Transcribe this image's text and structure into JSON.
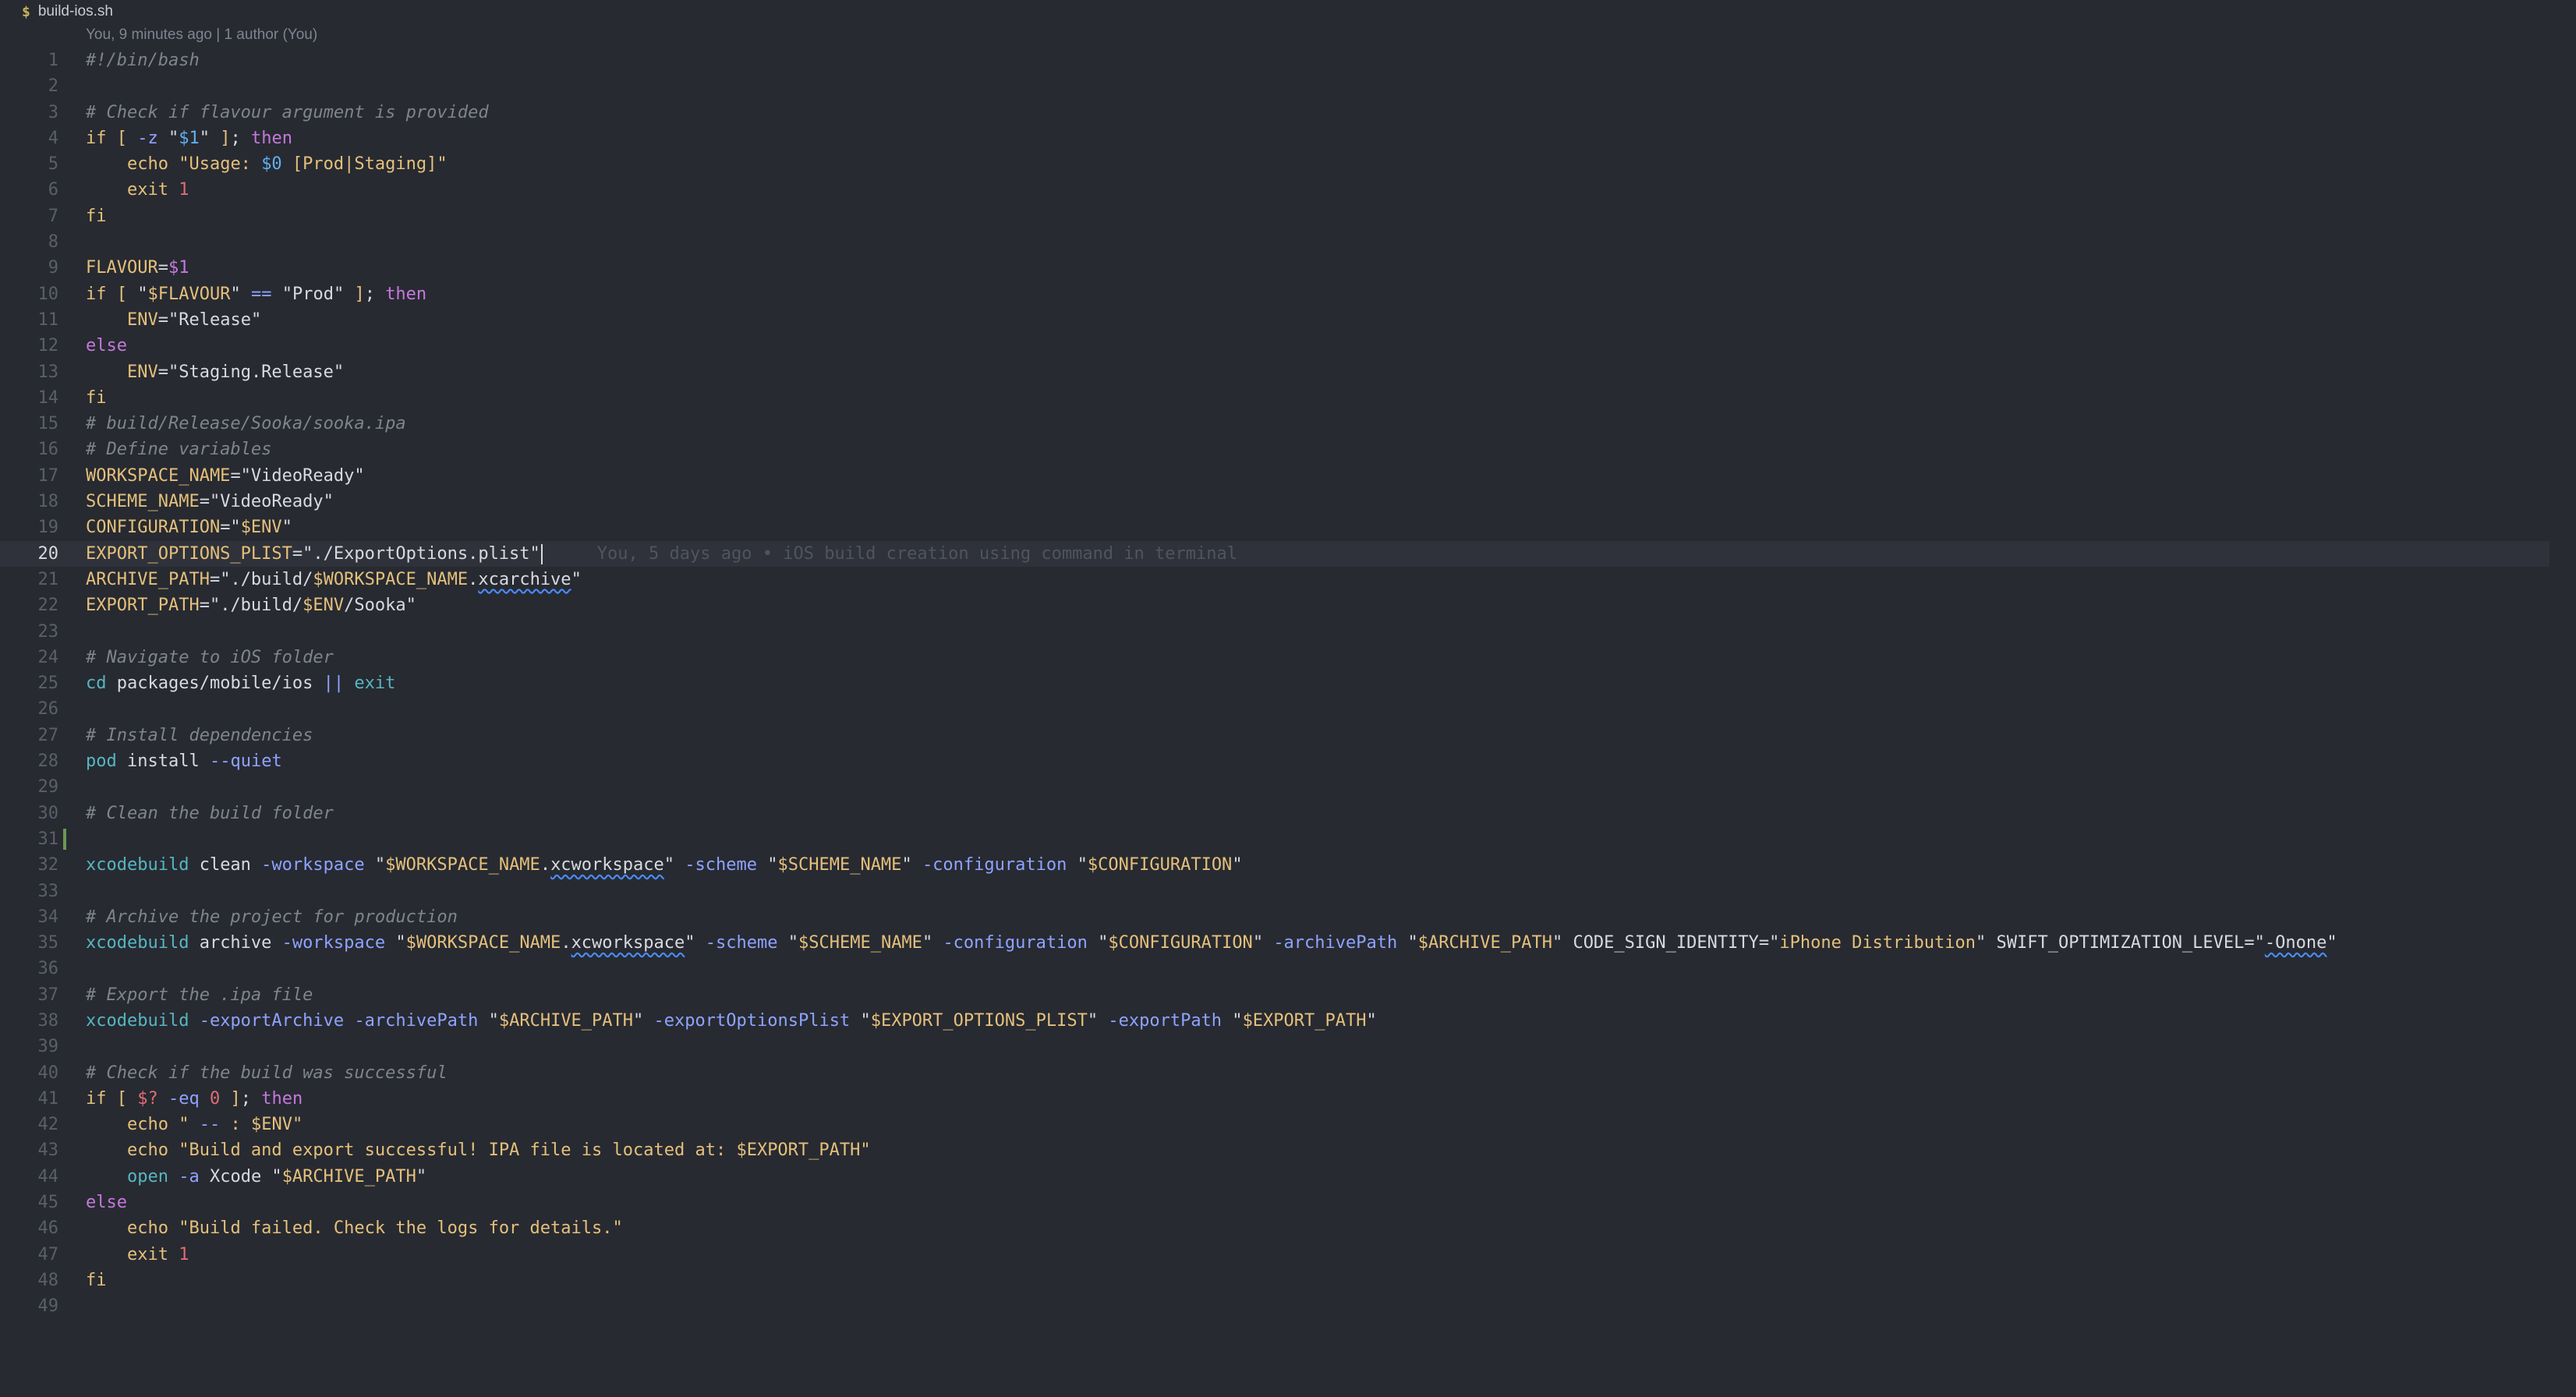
{
  "tab": {
    "icon": "$",
    "filename": "build-ios.sh"
  },
  "blame_header": "You, 9 minutes ago | 1 author (You)",
  "current_line": 20,
  "inline_blame": "You, 5 days ago • iOS build creation using command in terminal",
  "colors": {
    "background": "#272a31",
    "comment": "#7f848e",
    "keyword": "#c678dd",
    "string": "#e5c07b",
    "variable": "#c678dd",
    "builtin": "#56b6c2",
    "number": "#e06c75",
    "flag": "#8fa3ff"
  },
  "lines": [
    [
      {
        "t": "#!/bin/bash",
        "c": "cm"
      }
    ],
    [],
    [
      {
        "t": "# Check if flavour argument is provided",
        "c": "cm"
      }
    ],
    [
      {
        "t": "if",
        "c": "st"
      },
      {
        "t": " ",
        "c": "pl"
      },
      {
        "t": "[",
        "c": "st"
      },
      {
        "t": " -z ",
        "c": "fl"
      },
      {
        "t": "\"",
        "c": "pl"
      },
      {
        "t": "$1",
        "c": "vc"
      },
      {
        "t": "\"",
        "c": "pl"
      },
      {
        "t": " ",
        "c": "pl"
      },
      {
        "t": "]",
        "c": "st"
      },
      {
        "t": "; ",
        "c": "pl"
      },
      {
        "t": "then",
        "c": "kw"
      }
    ],
    [
      {
        "t": "    ",
        "c": "pl"
      },
      {
        "t": "echo",
        "c": "st"
      },
      {
        "t": " \"Usage: ",
        "c": "st"
      },
      {
        "t": "$0",
        "c": "vc"
      },
      {
        "t": " [Prod|Staging]\"",
        "c": "st"
      }
    ],
    [
      {
        "t": "    ",
        "c": "pl"
      },
      {
        "t": "exit",
        "c": "st"
      },
      {
        "t": " ",
        "c": "pl"
      },
      {
        "t": "1",
        "c": "nm"
      }
    ],
    [
      {
        "t": "fi",
        "c": "st"
      }
    ],
    [],
    [
      {
        "t": "FLAVOUR",
        "c": "st"
      },
      {
        "t": "=",
        "c": "pl"
      },
      {
        "t": "$1",
        "c": "vr"
      }
    ],
    [
      {
        "t": "if",
        "c": "st"
      },
      {
        "t": " ",
        "c": "pl"
      },
      {
        "t": "[",
        "c": "st"
      },
      {
        "t": " \"",
        "c": "pl"
      },
      {
        "t": "$FLAVOUR",
        "c": "st"
      },
      {
        "t": "\" ",
        "c": "pl"
      },
      {
        "t": "==",
        "c": "fl"
      },
      {
        "t": " \"Prod\" ",
        "c": "pl"
      },
      {
        "t": "]",
        "c": "st"
      },
      {
        "t": "; ",
        "c": "pl"
      },
      {
        "t": "then",
        "c": "kw"
      }
    ],
    [
      {
        "t": "    ",
        "c": "pl"
      },
      {
        "t": "ENV",
        "c": "st"
      },
      {
        "t": "=\"Release\"",
        "c": "pl"
      }
    ],
    [
      {
        "t": "else",
        "c": "kw"
      }
    ],
    [
      {
        "t": "    ",
        "c": "pl"
      },
      {
        "t": "ENV",
        "c": "st"
      },
      {
        "t": "=\"Staging.Release\"",
        "c": "pl"
      }
    ],
    [
      {
        "t": "fi",
        "c": "st"
      }
    ],
    [
      {
        "t": "# build/Release/Sooka/sooka.ipa",
        "c": "cm"
      }
    ],
    [
      {
        "t": "# Define variables",
        "c": "cm"
      }
    ],
    [
      {
        "t": "WORKSPACE_NAME",
        "c": "st"
      },
      {
        "t": "=\"VideoReady\"",
        "c": "pl"
      }
    ],
    [
      {
        "t": "SCHEME_NAME",
        "c": "st"
      },
      {
        "t": "=\"VideoReady\"",
        "c": "pl"
      }
    ],
    [
      {
        "t": "CONFIGURATION",
        "c": "st"
      },
      {
        "t": "=\"",
        "c": "pl"
      },
      {
        "t": "$ENV",
        "c": "st"
      },
      {
        "t": "\"",
        "c": "pl"
      }
    ],
    [
      {
        "t": "EXPORT_OPTIONS_PLIST",
        "c": "st"
      },
      {
        "t": "=\"./ExportOptions.plist\"",
        "c": "pl"
      }
    ],
    [
      {
        "t": "ARCHIVE_PATH",
        "c": "st"
      },
      {
        "t": "=\"./build/",
        "c": "pl"
      },
      {
        "t": "$WORKSPACE_NAME",
        "c": "st"
      },
      {
        "t": ".",
        "c": "pl"
      },
      {
        "t": "xcarchive",
        "c": "pl",
        "sq": true
      },
      {
        "t": "\"",
        "c": "pl"
      }
    ],
    [
      {
        "t": "EXPORT_PATH",
        "c": "st"
      },
      {
        "t": "=\"./build/",
        "c": "pl"
      },
      {
        "t": "$ENV",
        "c": "st"
      },
      {
        "t": "/Sooka\"",
        "c": "pl"
      }
    ],
    [],
    [
      {
        "t": "# Navigate to iOS folder",
        "c": "cm"
      }
    ],
    [
      {
        "t": "cd",
        "c": "fn"
      },
      {
        "t": " packages/mobile/ios ",
        "c": "pl"
      },
      {
        "t": "||",
        "c": "fl"
      },
      {
        "t": " ",
        "c": "pl"
      },
      {
        "t": "exit",
        "c": "fn"
      }
    ],
    [],
    [
      {
        "t": "# Install dependencies",
        "c": "cm"
      }
    ],
    [
      {
        "t": "pod",
        "c": "fn"
      },
      {
        "t": " install ",
        "c": "pl"
      },
      {
        "t": "--quiet",
        "c": "fl"
      }
    ],
    [],
    [
      {
        "t": "# Clean the build folder",
        "c": "cm"
      }
    ],
    [],
    [
      {
        "t": "xcodebuild",
        "c": "fn"
      },
      {
        "t": " clean ",
        "c": "pl"
      },
      {
        "t": "-workspace",
        "c": "fl"
      },
      {
        "t": " \"",
        "c": "pl"
      },
      {
        "t": "$WORKSPACE_NAME",
        "c": "st"
      },
      {
        "t": ".",
        "c": "pl"
      },
      {
        "t": "xcworkspace",
        "c": "pl",
        "sq": true
      },
      {
        "t": "\" ",
        "c": "pl"
      },
      {
        "t": "-scheme",
        "c": "fl"
      },
      {
        "t": " \"",
        "c": "pl"
      },
      {
        "t": "$SCHEME_NAME",
        "c": "st"
      },
      {
        "t": "\" ",
        "c": "pl"
      },
      {
        "t": "-configuration",
        "c": "fl"
      },
      {
        "t": " \"",
        "c": "pl"
      },
      {
        "t": "$CONFIGURATION",
        "c": "st"
      },
      {
        "t": "\"",
        "c": "pl"
      }
    ],
    [],
    [
      {
        "t": "# Archive the project for production",
        "c": "cm"
      }
    ],
    [
      {
        "t": "xcodebuild",
        "c": "fn"
      },
      {
        "t": " archive ",
        "c": "pl"
      },
      {
        "t": "-workspace",
        "c": "fl"
      },
      {
        "t": " \"",
        "c": "pl"
      },
      {
        "t": "$WORKSPACE_NAME",
        "c": "st"
      },
      {
        "t": ".",
        "c": "pl"
      },
      {
        "t": "xcworkspace",
        "c": "pl",
        "sq": true
      },
      {
        "t": "\" ",
        "c": "pl"
      },
      {
        "t": "-scheme",
        "c": "fl"
      },
      {
        "t": " \"",
        "c": "pl"
      },
      {
        "t": "$SCHEME_NAME",
        "c": "st"
      },
      {
        "t": "\" ",
        "c": "pl"
      },
      {
        "t": "-configuration",
        "c": "fl"
      },
      {
        "t": " \"",
        "c": "pl"
      },
      {
        "t": "$CONFIGURATION",
        "c": "st"
      },
      {
        "t": "\" ",
        "c": "pl"
      },
      {
        "t": "-archivePath",
        "c": "fl"
      },
      {
        "t": " \"",
        "c": "pl"
      },
      {
        "t": "$ARCHIVE_PATH",
        "c": "st"
      },
      {
        "t": "\" CODE_SIGN_IDENTITY=\"",
        "c": "pl"
      },
      {
        "t": "iPhone Distribution",
        "c": "st"
      },
      {
        "t": "\" SWIFT_OPTIMIZATION_LEVEL=\"",
        "c": "pl"
      },
      {
        "t": "-Onone",
        "c": "pl",
        "sq": true
      },
      {
        "t": "\"",
        "c": "pl"
      }
    ],
    [],
    [
      {
        "t": "# Export the .ipa file",
        "c": "cm"
      }
    ],
    [
      {
        "t": "xcodebuild",
        "c": "fn"
      },
      {
        "t": " ",
        "c": "pl"
      },
      {
        "t": "-exportArchive",
        "c": "fl"
      },
      {
        "t": " ",
        "c": "pl"
      },
      {
        "t": "-archivePath",
        "c": "fl"
      },
      {
        "t": " \"",
        "c": "pl"
      },
      {
        "t": "$ARCHIVE_PATH",
        "c": "st"
      },
      {
        "t": "\" ",
        "c": "pl"
      },
      {
        "t": "-exportOptionsPlist",
        "c": "fl"
      },
      {
        "t": " \"",
        "c": "pl"
      },
      {
        "t": "$EXPORT_OPTIONS_PLIST",
        "c": "st"
      },
      {
        "t": "\" ",
        "c": "pl"
      },
      {
        "t": "-exportPath",
        "c": "fl"
      },
      {
        "t": " \"",
        "c": "pl"
      },
      {
        "t": "$EXPORT_PATH",
        "c": "st"
      },
      {
        "t": "\"",
        "c": "pl"
      }
    ],
    [],
    [
      {
        "t": "# Check if the build was successful",
        "c": "cm"
      }
    ],
    [
      {
        "t": "if",
        "c": "st"
      },
      {
        "t": " ",
        "c": "pl"
      },
      {
        "t": "[",
        "c": "st"
      },
      {
        "t": " ",
        "c": "pl"
      },
      {
        "t": "$?",
        "c": "nm"
      },
      {
        "t": " ",
        "c": "pl"
      },
      {
        "t": "-eq",
        "c": "fl"
      },
      {
        "t": " ",
        "c": "pl"
      },
      {
        "t": "0",
        "c": "nm"
      },
      {
        "t": " ",
        "c": "pl"
      },
      {
        "t": "]",
        "c": "st"
      },
      {
        "t": "; ",
        "c": "pl"
      },
      {
        "t": "then",
        "c": "kw"
      }
    ],
    [
      {
        "t": "    ",
        "c": "pl"
      },
      {
        "t": "echo",
        "c": "st"
      },
      {
        "t": " \" ",
        "c": "st"
      },
      {
        "t": "--",
        "c": "fl"
      },
      {
        "t": " : ",
        "c": "st"
      },
      {
        "t": "$ENV",
        "c": "st"
      },
      {
        "t": "\"",
        "c": "st"
      }
    ],
    [
      {
        "t": "    ",
        "c": "pl"
      },
      {
        "t": "echo",
        "c": "st"
      },
      {
        "t": " \"Build and export successful! IPA file is located at: ",
        "c": "st"
      },
      {
        "t": "$EXPORT_PATH",
        "c": "st"
      },
      {
        "t": "\"",
        "c": "st"
      }
    ],
    [
      {
        "t": "    ",
        "c": "pl"
      },
      {
        "t": "open",
        "c": "fn"
      },
      {
        "t": " ",
        "c": "pl"
      },
      {
        "t": "-a",
        "c": "fl"
      },
      {
        "t": " Xcode \"",
        "c": "pl"
      },
      {
        "t": "$ARCHIVE_PATH",
        "c": "st"
      },
      {
        "t": "\"",
        "c": "pl"
      }
    ],
    [
      {
        "t": "else",
        "c": "kw"
      }
    ],
    [
      {
        "t": "    ",
        "c": "pl"
      },
      {
        "t": "echo",
        "c": "st"
      },
      {
        "t": " \"Build failed. Check the logs for details.\"",
        "c": "st"
      }
    ],
    [
      {
        "t": "    ",
        "c": "pl"
      },
      {
        "t": "exit",
        "c": "st"
      },
      {
        "t": " ",
        "c": "pl"
      },
      {
        "t": "1",
        "c": "nm"
      }
    ],
    [
      {
        "t": "fi",
        "c": "st"
      }
    ],
    []
  ]
}
